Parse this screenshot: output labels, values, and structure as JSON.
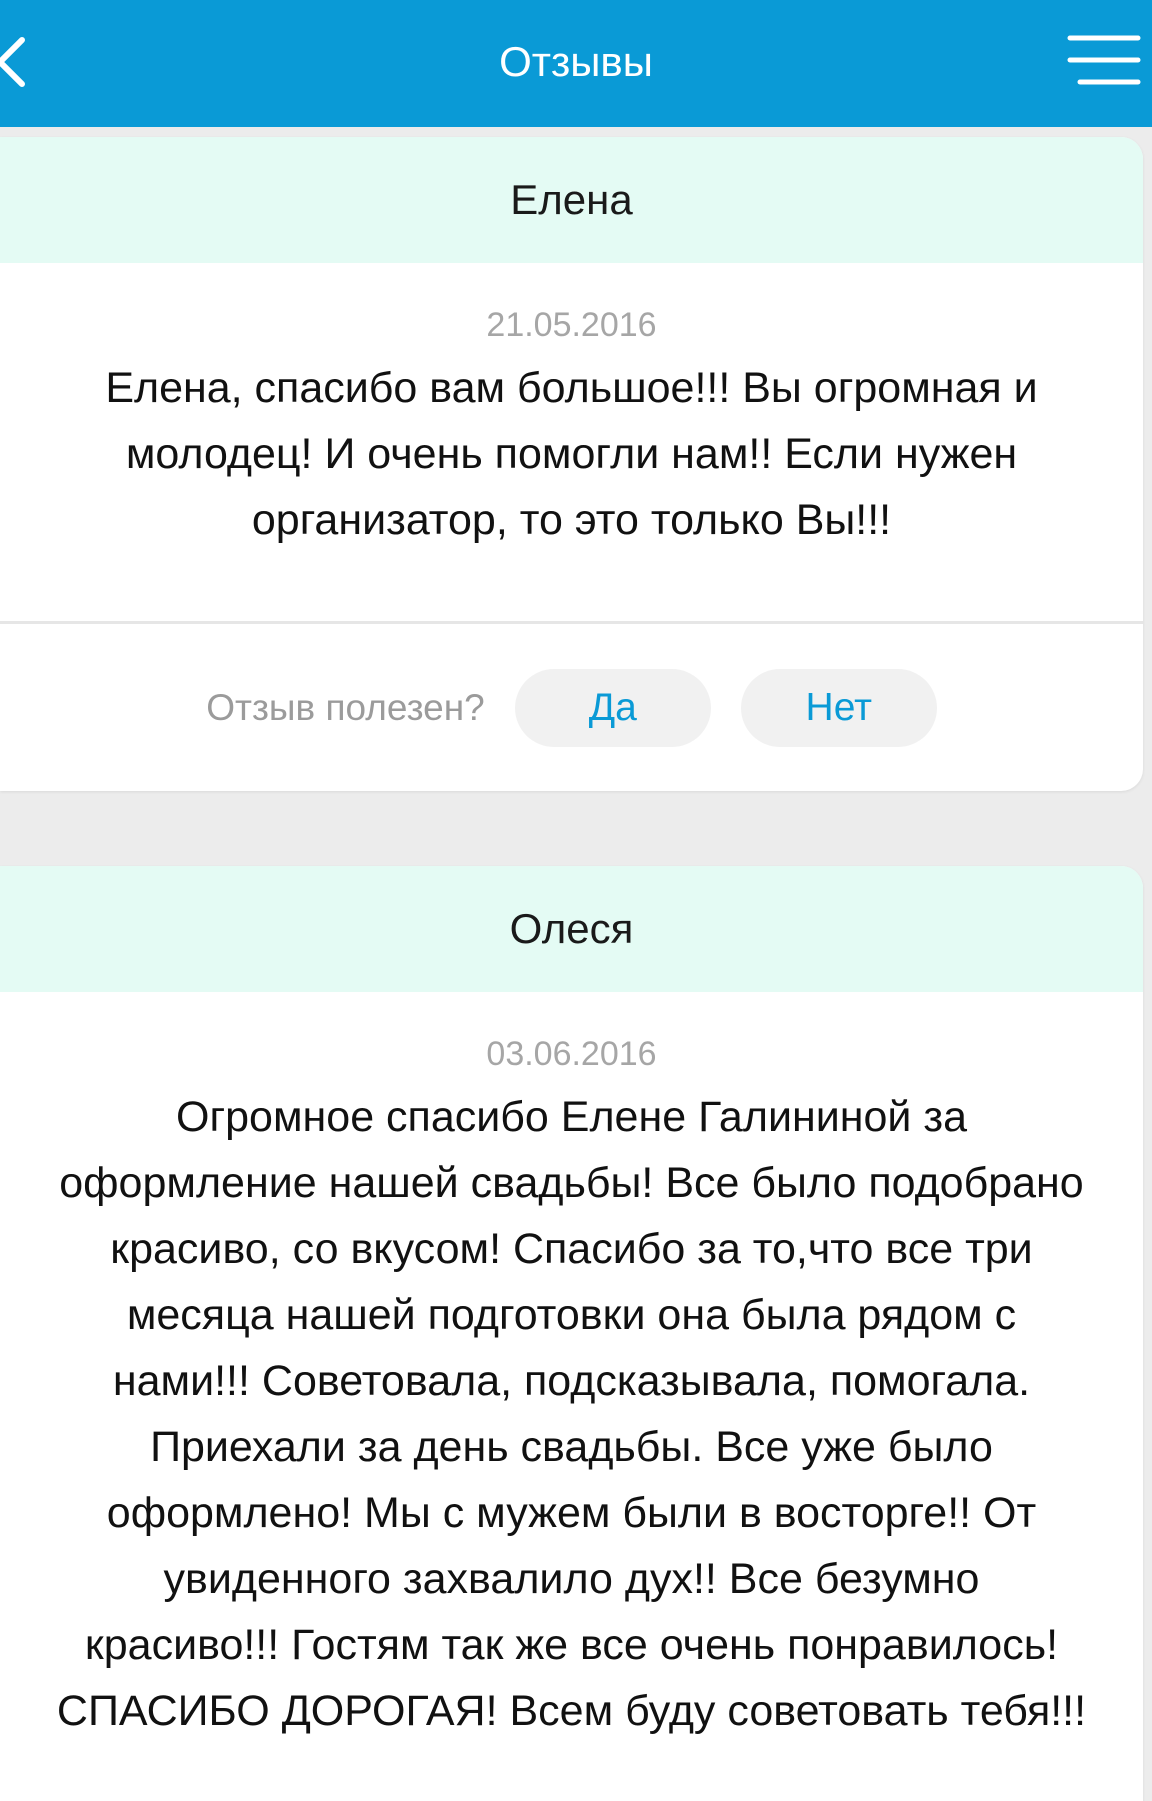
{
  "header": {
    "title": "Отзывы",
    "back_icon": "chevron-left-icon",
    "menu_icon": "hamburger-menu-icon",
    "color": "#0a9ad6"
  },
  "reviews": [
    {
      "author": "Елена",
      "date": "21.05.2016",
      "lines": [
        "Елена, спасибо вам большое!!! Вы огромная и",
        "молодец! И очень помогли нам!! Если нужен",
        "организатор, то это только Вы!!!"
      ],
      "feedback": {
        "question": "Отзыв полезен?",
        "yes": "Да",
        "no": "Нет"
      }
    },
    {
      "author": "Олеся",
      "date": "03.06.2016",
      "lines": [
        "Огромное спасибо Елене Галининой за",
        "оформление нашей свадьбы!  Все было подобрано",
        "красиво, со вкусом!  Спасибо за то,что все три",
        "месяца нашей подготовки она была рядом с",
        "нами!!!  Советовала, подсказывала, помогала.",
        "Приехали за день свадьбы. Все уже было",
        "оформлено!  Мы с мужем были в восторге!! От",
        "увиденного захвалило дух!!  Все безумно",
        "красиво!!!  Гостям так же все очень понравилось!",
        "СПАСИБО ДОРОГАЯ!  Всем буду советовать тебя!!!"
      ]
    }
  ]
}
